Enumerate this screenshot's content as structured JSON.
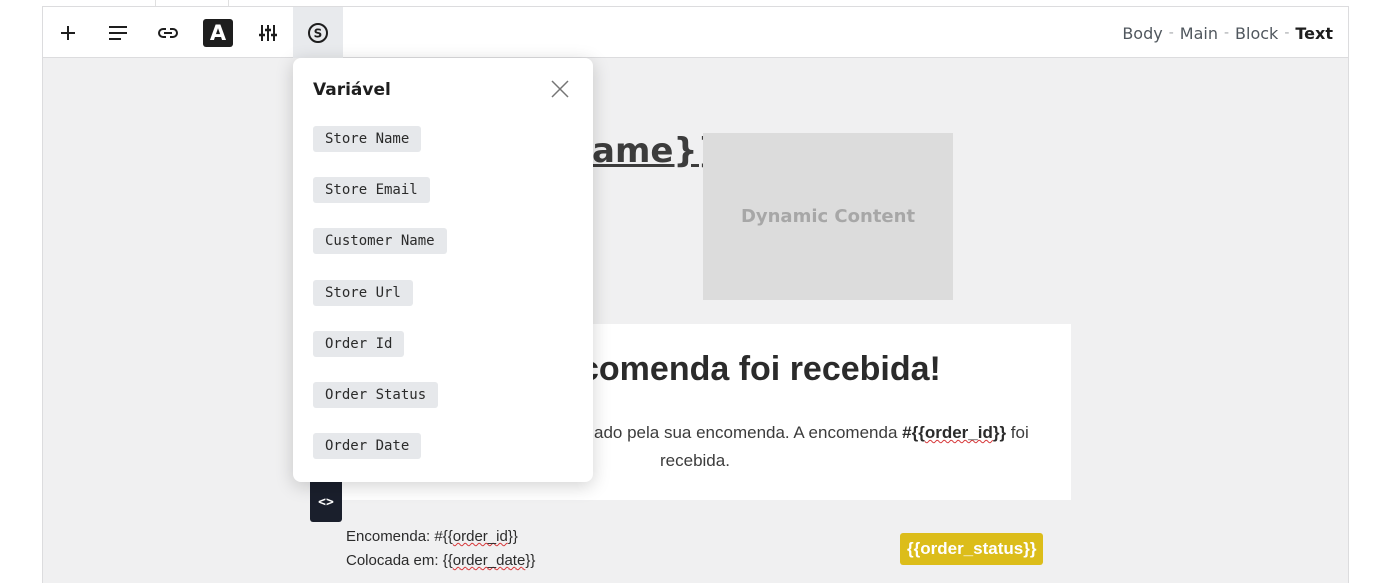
{
  "toolbar": {
    "buttons": [
      "add",
      "align",
      "link",
      "text-style",
      "settings",
      "variable"
    ],
    "text_style_letter": "A",
    "breadcrumb": [
      "Body",
      "Main",
      "Block",
      "Text"
    ],
    "breadcrumb_sep": "-"
  },
  "canvas": {
    "store_title_fragment": "ame}}",
    "dynamic_content_label": "Dynamic Content",
    "heading_fragment": "comenda foi recebida!",
    "para_line1_prefix": "ado pela sua encomenda. A encomenda ",
    "para_line1_bold_hash": "#{{",
    "para_line1_bold_var": "order_id",
    "para_line1_bold_close": "}}",
    "para_line1_suffix": " foi",
    "para_line2": "recebida.",
    "code_button_label": "<>",
    "order_label": "Encomenda: #{{",
    "order_var": "order_id",
    "order_close": "}}",
    "placed_label": "Colocada em: {{",
    "placed_var": "order_date",
    "placed_close": "}}",
    "status_badge": "{{order_status}}",
    "badge_color": "#dcbd1a"
  },
  "variable_popover": {
    "title": "Variável",
    "items": [
      "Store Name",
      "Store Email",
      "Customer Name",
      "Store Url",
      "Order Id",
      "Order Status",
      "Order Date"
    ]
  }
}
